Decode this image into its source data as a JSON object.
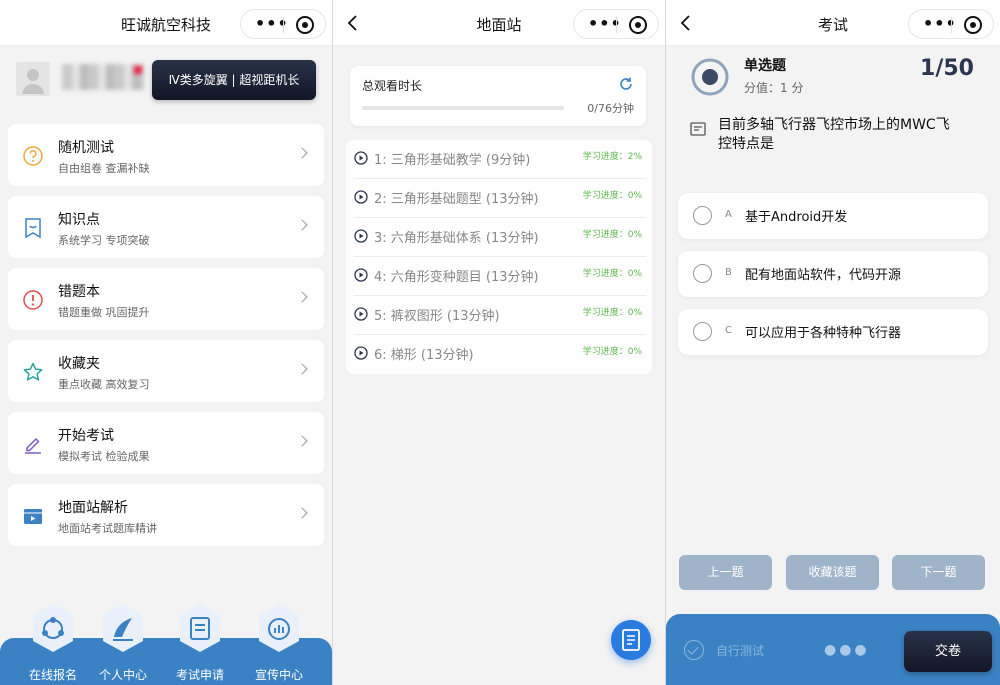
{
  "home": {
    "title": "旺诚航空科技",
    "promo_label": "Ⅳ类多旋翼 | 超视距机长",
    "menu": [
      {
        "title": "随机测试",
        "subtitle": "自由组卷 查漏补缺",
        "icon": "question-circle-icon",
        "color": "#f0a73b"
      },
      {
        "title": "知识点",
        "subtitle": "系统学习 专项突破",
        "icon": "bookmark-icon",
        "color": "#3b82c4"
      },
      {
        "title": "错题本",
        "subtitle": "错题重做 巩固提升",
        "icon": "alert-circle-icon",
        "color": "#e24c4c"
      },
      {
        "title": "收藏夹",
        "subtitle": "重点收藏 高效复习",
        "icon": "star-icon",
        "color": "#2ba39a"
      },
      {
        "title": "开始考试",
        "subtitle": "模拟考试 检验成果",
        "icon": "pencil-icon",
        "color": "#7a5bc9"
      },
      {
        "title": "地面站解析",
        "subtitle": "地面站考试题库精讲",
        "icon": "video-icon",
        "color": "#3b82c4"
      }
    ],
    "tabs": [
      {
        "label": "在线报名",
        "icon": "register-icon"
      },
      {
        "label": "个人中心",
        "icon": "profile-icon"
      },
      {
        "label": "考试申请",
        "icon": "exam-apply-icon"
      },
      {
        "label": "宣传中心",
        "icon": "promo-center-icon"
      }
    ]
  },
  "station": {
    "title": "地面站",
    "watch_title": "总观看时长",
    "watch_progress": 0,
    "watch_count": "0/76分钟",
    "lessons": [
      {
        "name": "1: 三角形基础教学 (9分钟)",
        "progress": "学习进度：2%"
      },
      {
        "name": "2: 三角形基础题型 (13分钟)",
        "progress": "学习进度：0%"
      },
      {
        "name": "3: 六角形基础体系 (13分钟)",
        "progress": "学习进度：0%"
      },
      {
        "name": "4: 六角形变种题目 (13分钟)",
        "progress": "学习进度：0%"
      },
      {
        "name": "5: 裤衩图形 (13分钟)",
        "progress": "学习进度：0%"
      },
      {
        "name": "6: 梯形 (13分钟)",
        "progress": "学习进度：0%"
      }
    ]
  },
  "exam": {
    "title": "考试",
    "question_type": "单选题",
    "score": "分值：1 分",
    "counter": "1/50",
    "question": "目前多轴飞行器飞控市场上的MWC飞控特点是",
    "options": [
      {
        "letter": "A",
        "text": "基于Android开发"
      },
      {
        "letter": "B",
        "text": "配有地面站软件，代码开源"
      },
      {
        "letter": "C",
        "text": "可以应用于各种特种飞行器"
      }
    ],
    "prev_label": "上一题",
    "fav_label": "收藏该题",
    "next_label": "下一题",
    "self_test_label": "自行测试",
    "dots": "●●●",
    "submit_label": "交卷"
  },
  "capsule": {
    "more": "•••"
  },
  "colors": {
    "accent": "#3b82c4",
    "dark": "#1a2236",
    "progress_green": "#5fb84f"
  }
}
